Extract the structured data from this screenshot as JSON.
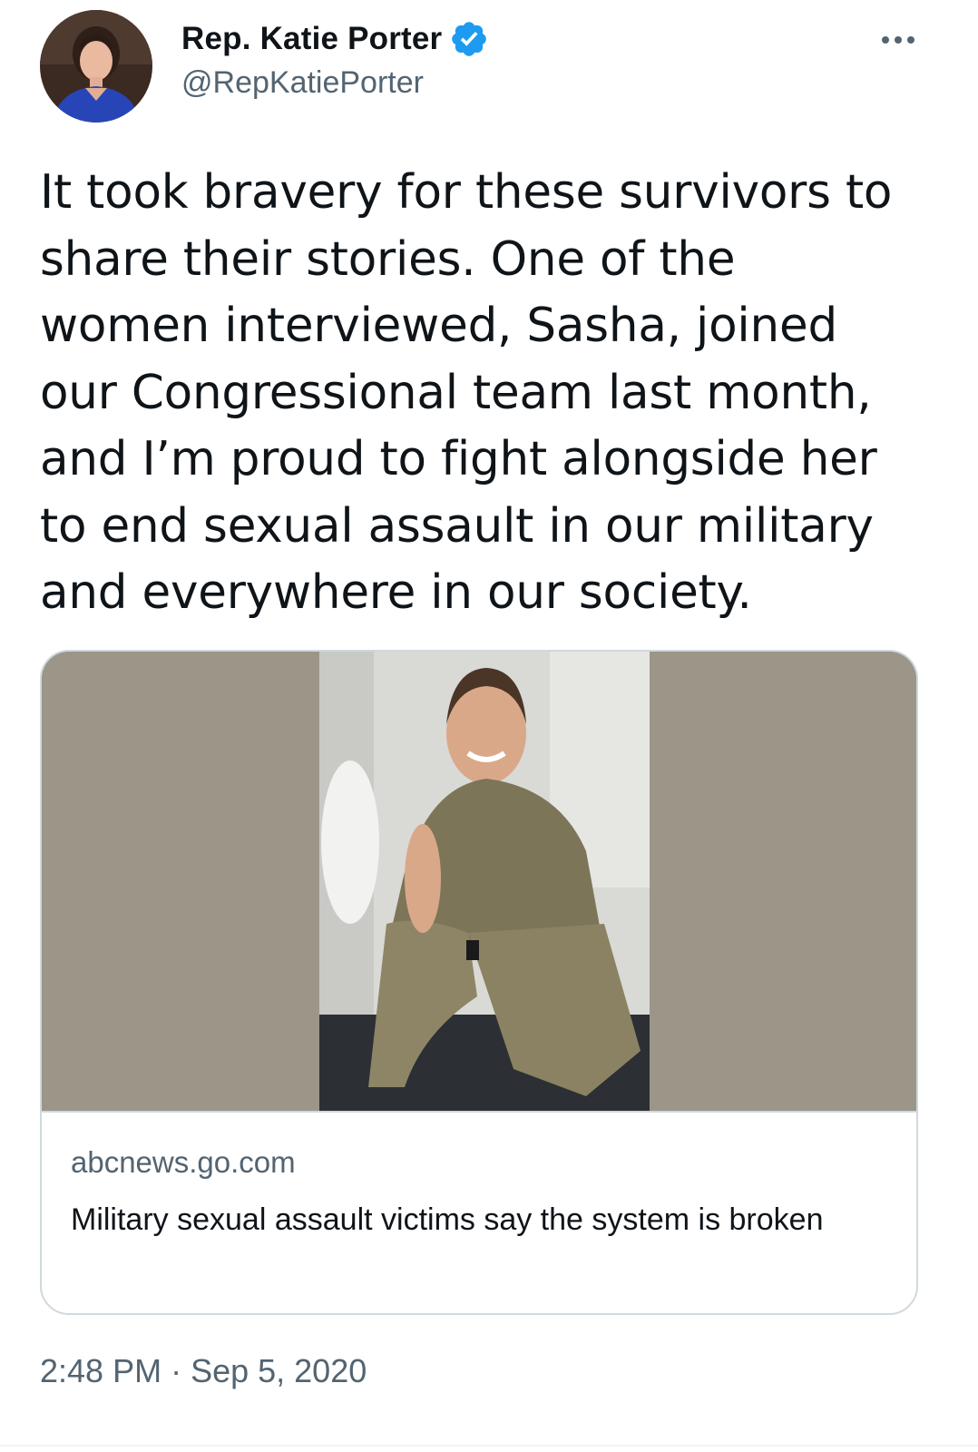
{
  "author": {
    "display_name": "Rep. Katie Porter",
    "handle": "@RepKatiePorter",
    "verified": true,
    "avatar_icon": "profile-photo",
    "verified_icon": "verified-badge-icon"
  },
  "menu": {
    "icon": "more-options-icon"
  },
  "tweet": {
    "text": "It took bravery for these survivors to\nshare their stories. One of the\nwomen interviewed, Sasha, joined\nour Congressional team last month,\nand I’m proud to fight alongside her\nto end sexual assault in our military\nand everywhere in our society."
  },
  "link_card": {
    "image_icon": "article-photo",
    "domain": "abcnews.go.com",
    "title": "Military sexual assault victims say the system is broken"
  },
  "meta": {
    "time": "2:48 PM",
    "separator": "·",
    "date": "Sep 5, 2020"
  },
  "colors": {
    "text_primary": "#0f1419",
    "text_secondary": "#536471",
    "verified_blue": "#1d9bf0",
    "card_border": "#cfd9de",
    "photo_background": "#9c9689"
  }
}
